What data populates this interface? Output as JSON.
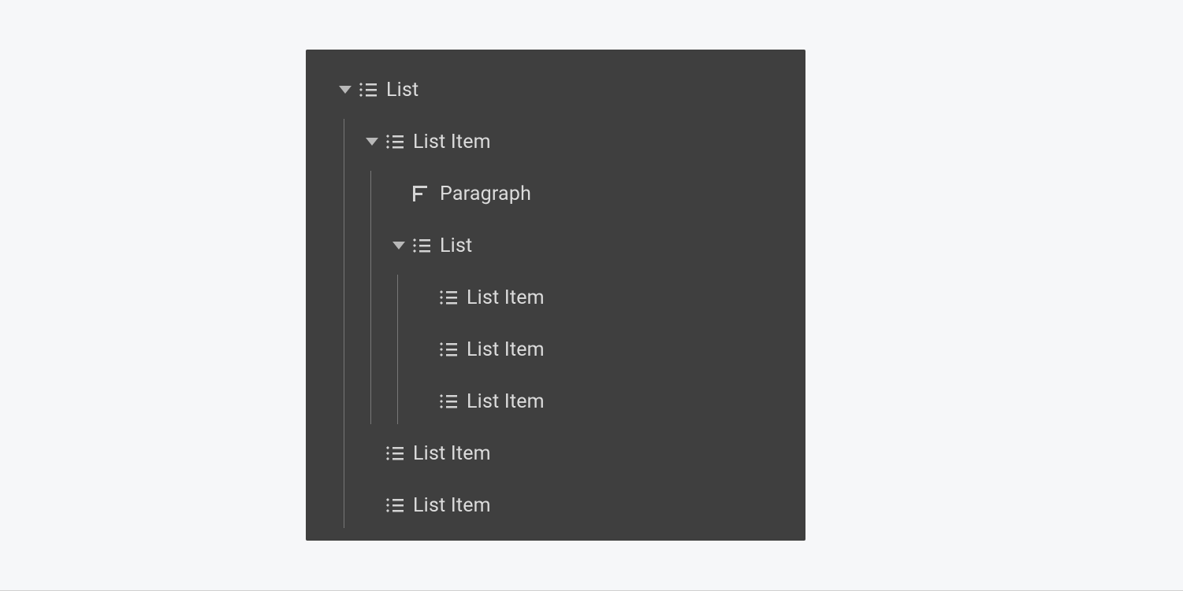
{
  "tree": {
    "root": {
      "label": "List",
      "icon": "list",
      "expanded": true,
      "children": {
        "item0": {
          "label": "List Item",
          "icon": "list",
          "expanded": true,
          "paragraph": {
            "label": "Paragraph",
            "icon": "paragraph"
          },
          "sublist": {
            "label": "List",
            "icon": "list",
            "expanded": true,
            "children": {
              "i0": {
                "label": "List Item",
                "icon": "list"
              },
              "i1": {
                "label": "List Item",
                "icon": "list"
              },
              "i2": {
                "label": "List Item",
                "icon": "list"
              }
            }
          }
        },
        "item1": {
          "label": "List Item",
          "icon": "list"
        },
        "item2": {
          "label": "List Item",
          "icon": "list"
        }
      }
    }
  }
}
